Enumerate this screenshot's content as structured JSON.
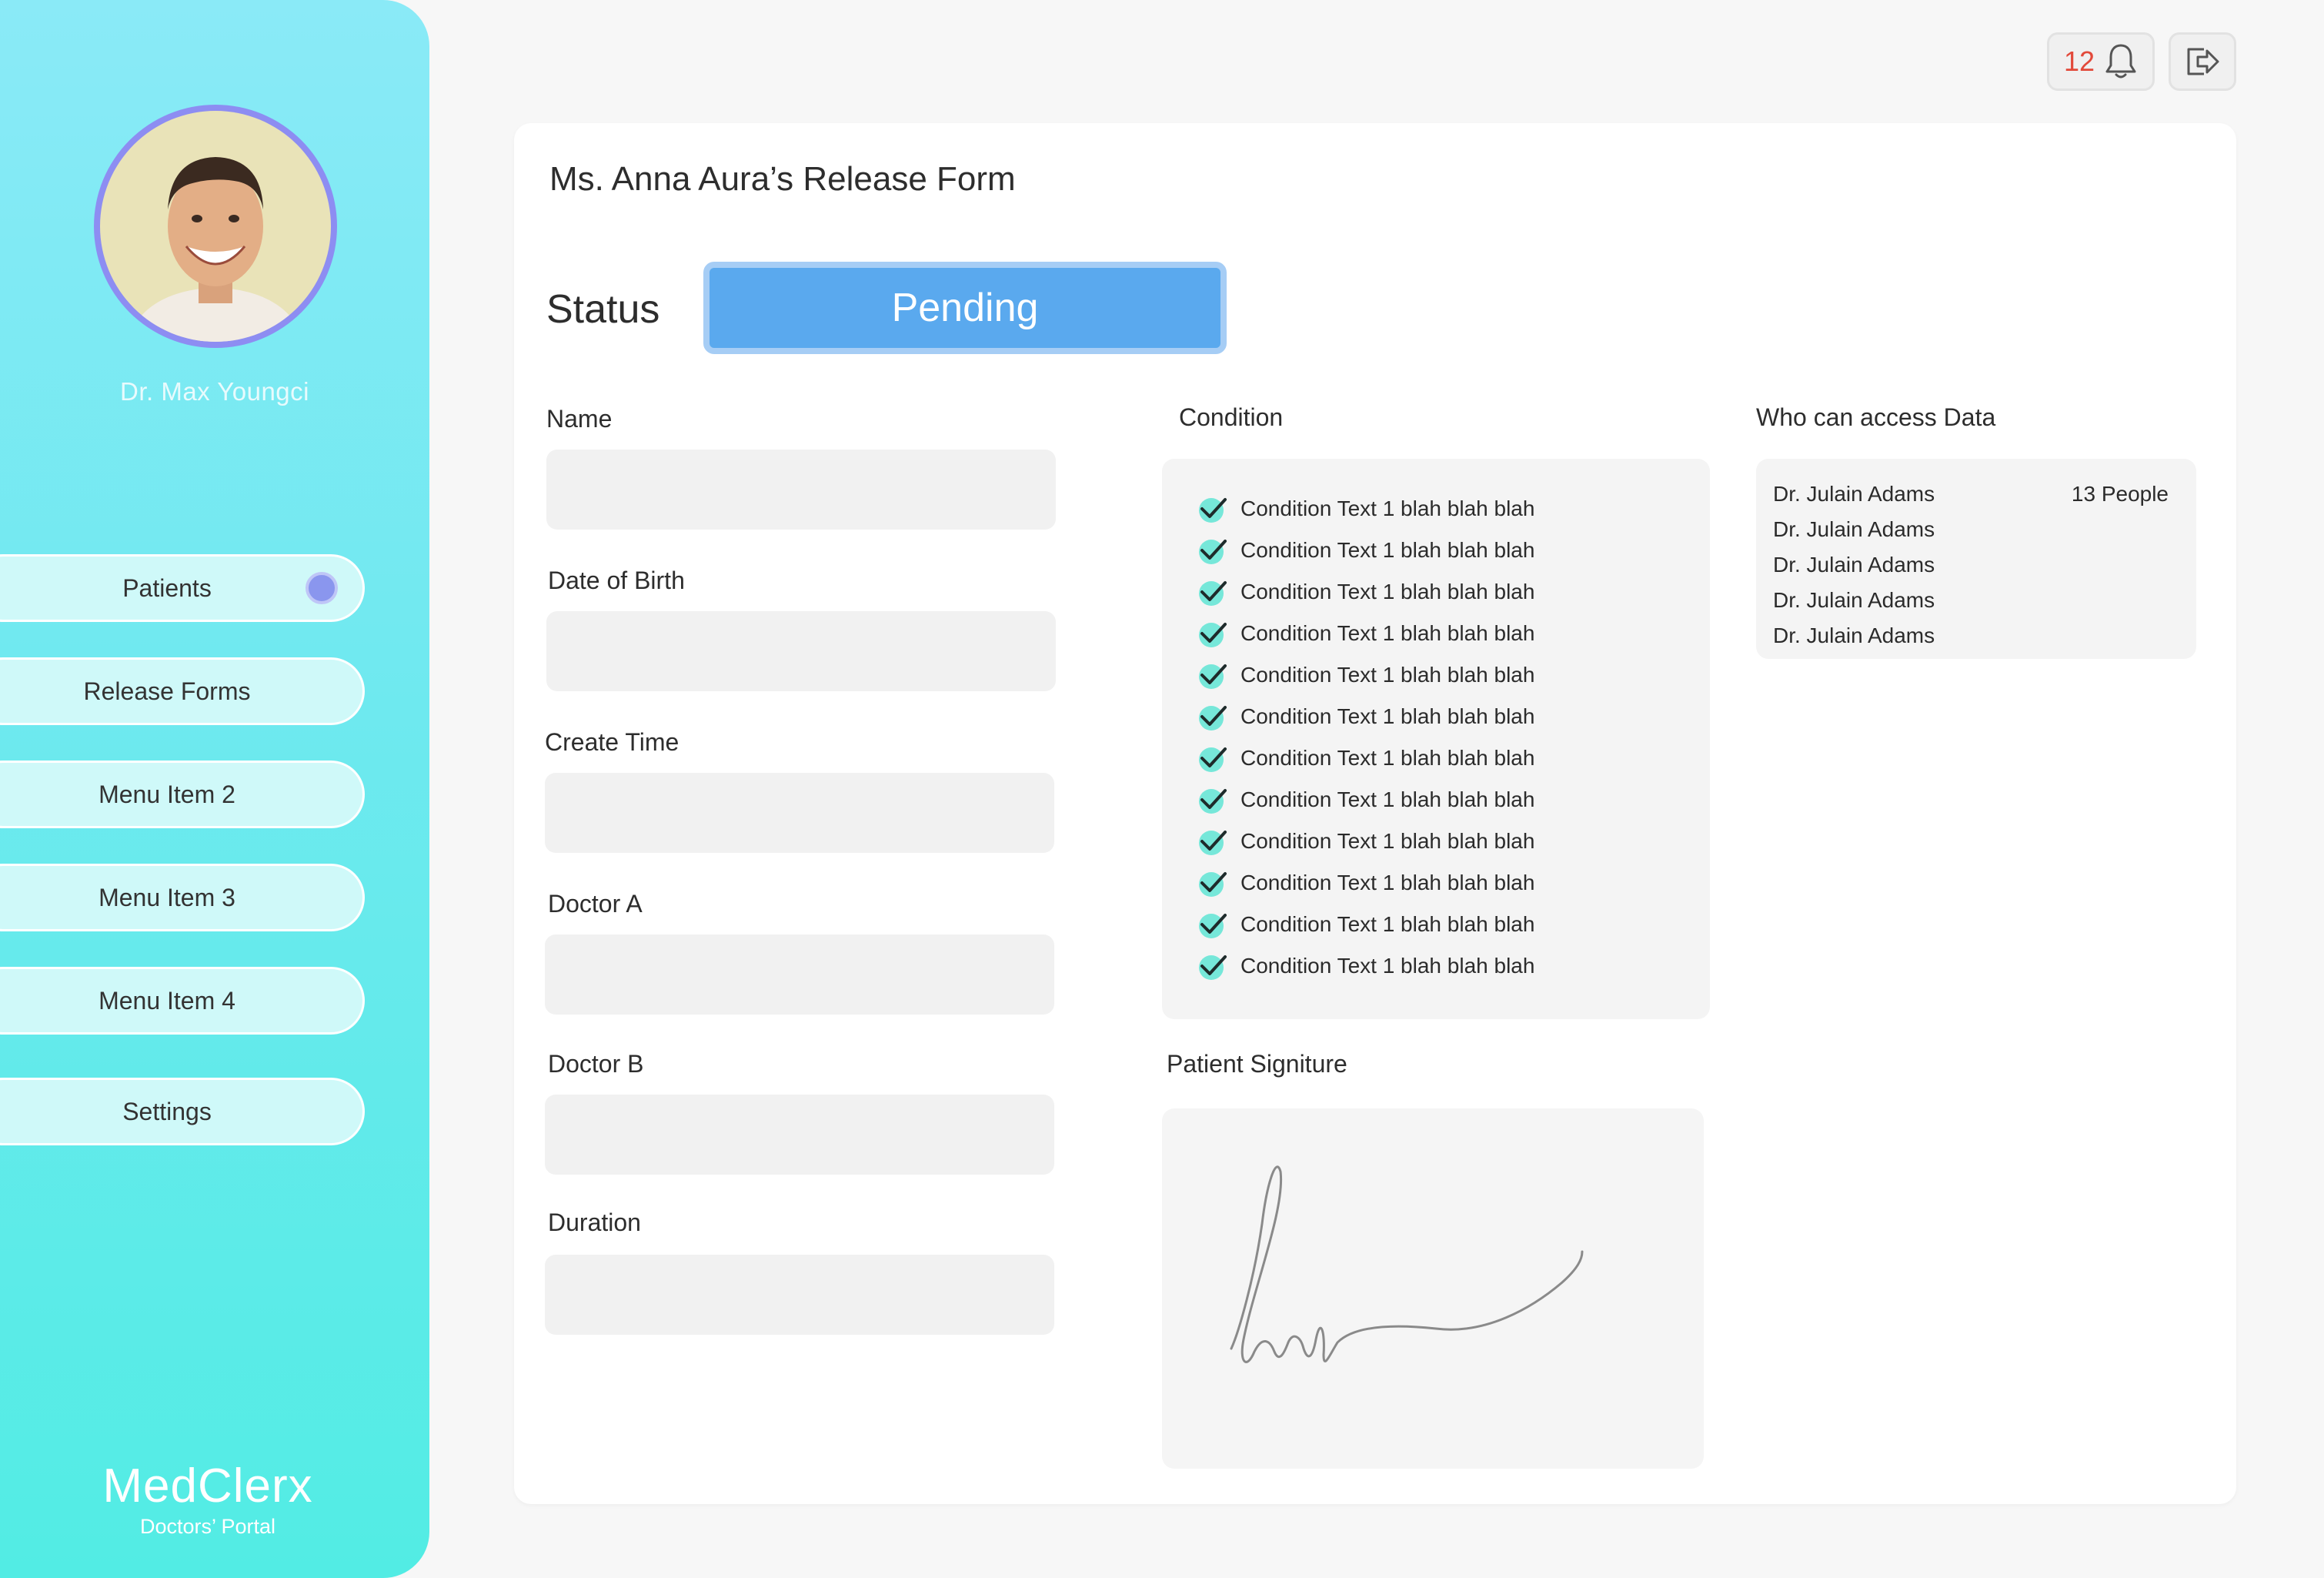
{
  "sidebar": {
    "doctor_name": "Dr. Max Youngci",
    "nav": [
      {
        "label": "Patients",
        "active": true
      },
      {
        "label": "Release Forms"
      },
      {
        "label": "Menu Item 2"
      },
      {
        "label": "Menu Item 3"
      },
      {
        "label": "Menu Item 4"
      },
      {
        "label": "Settings"
      }
    ],
    "brand_name": "MedClerx",
    "brand_sub": "Doctors’ Portal"
  },
  "header": {
    "notification_count": "12",
    "notification_icon": "bell-icon",
    "logout_icon": "logout-icon"
  },
  "form": {
    "title": "Ms. Anna Aura’s Release Form",
    "status_label": "Status",
    "status_value": "Pending",
    "fields": [
      {
        "label": "Name",
        "value": ""
      },
      {
        "label": "Date of Birth",
        "value": ""
      },
      {
        "label": "Create Time",
        "value": ""
      },
      {
        "label": "Doctor A",
        "value": ""
      },
      {
        "label": "Doctor B",
        "value": ""
      },
      {
        "label": "Duration",
        "value": ""
      }
    ],
    "condition_label": "Condition",
    "conditions": [
      "Condition Text 1 blah blah blah",
      "Condition Text 1 blah blah blah",
      "Condition Text 1 blah blah blah",
      "Condition Text 1 blah blah blah",
      "Condition Text 1 blah blah blah",
      "Condition Text 1 blah blah blah",
      "Condition Text 1 blah blah blah",
      "Condition Text 1 blah blah blah",
      "Condition Text 1 blah blah blah",
      "Condition Text 1 blah blah blah",
      "Condition Text 1 blah blah blah",
      "Condition Text 1 blah blah blah"
    ],
    "access_label": "Who can access Data",
    "access_list": [
      "Dr. Julain Adams",
      "Dr. Julain Adams",
      "Dr. Julain Adams",
      "Dr. Julain Adams",
      "Dr. Julain Adams"
    ],
    "access_count": "13 People",
    "signature_label": "Patient Signiture"
  },
  "colors": {
    "status_blue": "#5aa9ee",
    "check_teal": "#5fe4d4",
    "notification_red": "#e2493a",
    "nav_dot": "#8a96ee"
  }
}
